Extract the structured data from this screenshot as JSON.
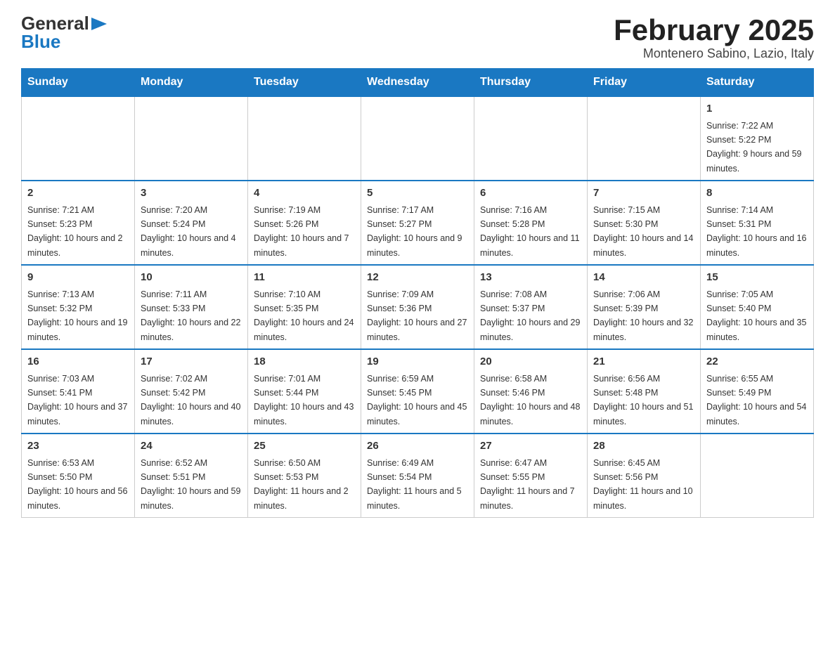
{
  "header": {
    "logo": {
      "general": "General",
      "arrow": "▶",
      "blue": "Blue"
    },
    "title": "February 2025",
    "location": "Montenero Sabino, Lazio, Italy"
  },
  "days_of_week": [
    "Sunday",
    "Monday",
    "Tuesday",
    "Wednesday",
    "Thursday",
    "Friday",
    "Saturday"
  ],
  "weeks": [
    [
      {
        "day": "",
        "info": ""
      },
      {
        "day": "",
        "info": ""
      },
      {
        "day": "",
        "info": ""
      },
      {
        "day": "",
        "info": ""
      },
      {
        "day": "",
        "info": ""
      },
      {
        "day": "",
        "info": ""
      },
      {
        "day": "1",
        "info": "Sunrise: 7:22 AM\nSunset: 5:22 PM\nDaylight: 9 hours and 59 minutes."
      }
    ],
    [
      {
        "day": "2",
        "info": "Sunrise: 7:21 AM\nSunset: 5:23 PM\nDaylight: 10 hours and 2 minutes."
      },
      {
        "day": "3",
        "info": "Sunrise: 7:20 AM\nSunset: 5:24 PM\nDaylight: 10 hours and 4 minutes."
      },
      {
        "day": "4",
        "info": "Sunrise: 7:19 AM\nSunset: 5:26 PM\nDaylight: 10 hours and 7 minutes."
      },
      {
        "day": "5",
        "info": "Sunrise: 7:17 AM\nSunset: 5:27 PM\nDaylight: 10 hours and 9 minutes."
      },
      {
        "day": "6",
        "info": "Sunrise: 7:16 AM\nSunset: 5:28 PM\nDaylight: 10 hours and 11 minutes."
      },
      {
        "day": "7",
        "info": "Sunrise: 7:15 AM\nSunset: 5:30 PM\nDaylight: 10 hours and 14 minutes."
      },
      {
        "day": "8",
        "info": "Sunrise: 7:14 AM\nSunset: 5:31 PM\nDaylight: 10 hours and 16 minutes."
      }
    ],
    [
      {
        "day": "9",
        "info": "Sunrise: 7:13 AM\nSunset: 5:32 PM\nDaylight: 10 hours and 19 minutes."
      },
      {
        "day": "10",
        "info": "Sunrise: 7:11 AM\nSunset: 5:33 PM\nDaylight: 10 hours and 22 minutes."
      },
      {
        "day": "11",
        "info": "Sunrise: 7:10 AM\nSunset: 5:35 PM\nDaylight: 10 hours and 24 minutes."
      },
      {
        "day": "12",
        "info": "Sunrise: 7:09 AM\nSunset: 5:36 PM\nDaylight: 10 hours and 27 minutes."
      },
      {
        "day": "13",
        "info": "Sunrise: 7:08 AM\nSunset: 5:37 PM\nDaylight: 10 hours and 29 minutes."
      },
      {
        "day": "14",
        "info": "Sunrise: 7:06 AM\nSunset: 5:39 PM\nDaylight: 10 hours and 32 minutes."
      },
      {
        "day": "15",
        "info": "Sunrise: 7:05 AM\nSunset: 5:40 PM\nDaylight: 10 hours and 35 minutes."
      }
    ],
    [
      {
        "day": "16",
        "info": "Sunrise: 7:03 AM\nSunset: 5:41 PM\nDaylight: 10 hours and 37 minutes."
      },
      {
        "day": "17",
        "info": "Sunrise: 7:02 AM\nSunset: 5:42 PM\nDaylight: 10 hours and 40 minutes."
      },
      {
        "day": "18",
        "info": "Sunrise: 7:01 AM\nSunset: 5:44 PM\nDaylight: 10 hours and 43 minutes."
      },
      {
        "day": "19",
        "info": "Sunrise: 6:59 AM\nSunset: 5:45 PM\nDaylight: 10 hours and 45 minutes."
      },
      {
        "day": "20",
        "info": "Sunrise: 6:58 AM\nSunset: 5:46 PM\nDaylight: 10 hours and 48 minutes."
      },
      {
        "day": "21",
        "info": "Sunrise: 6:56 AM\nSunset: 5:48 PM\nDaylight: 10 hours and 51 minutes."
      },
      {
        "day": "22",
        "info": "Sunrise: 6:55 AM\nSunset: 5:49 PM\nDaylight: 10 hours and 54 minutes."
      }
    ],
    [
      {
        "day": "23",
        "info": "Sunrise: 6:53 AM\nSunset: 5:50 PM\nDaylight: 10 hours and 56 minutes."
      },
      {
        "day": "24",
        "info": "Sunrise: 6:52 AM\nSunset: 5:51 PM\nDaylight: 10 hours and 59 minutes."
      },
      {
        "day": "25",
        "info": "Sunrise: 6:50 AM\nSunset: 5:53 PM\nDaylight: 11 hours and 2 minutes."
      },
      {
        "day": "26",
        "info": "Sunrise: 6:49 AM\nSunset: 5:54 PM\nDaylight: 11 hours and 5 minutes."
      },
      {
        "day": "27",
        "info": "Sunrise: 6:47 AM\nSunset: 5:55 PM\nDaylight: 11 hours and 7 minutes."
      },
      {
        "day": "28",
        "info": "Sunrise: 6:45 AM\nSunset: 5:56 PM\nDaylight: 11 hours and 10 minutes."
      },
      {
        "day": "",
        "info": ""
      }
    ]
  ]
}
